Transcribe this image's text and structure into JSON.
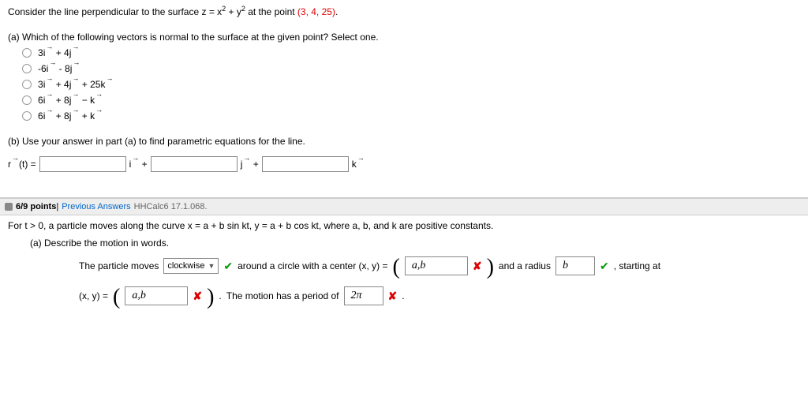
{
  "q1": {
    "intro_a": "Consider the line perpendicular to the surface z = x",
    "intro_b": " + y",
    "intro_c": " at the point ",
    "point": "(3, 4, 25)",
    "period": ".",
    "partA": "(a) Which of the following vectors is normal to the surface at the given point? Select one.",
    "opts": [
      [
        {
          "c": "3",
          "v": "i"
        },
        {
          "t": " + "
        },
        {
          "c": "4",
          "v": "j"
        }
      ],
      [
        {
          "c": "-6",
          "v": "i"
        },
        {
          "t": " - "
        },
        {
          "c": "8",
          "v": "j"
        }
      ],
      [
        {
          "c": "3",
          "v": "i"
        },
        {
          "t": " + "
        },
        {
          "c": "4",
          "v": "j"
        },
        {
          "t": " + "
        },
        {
          "c": "25",
          "v": "k"
        }
      ],
      [
        {
          "c": "6",
          "v": "i"
        },
        {
          "t": " + "
        },
        {
          "c": "8",
          "v": "j"
        },
        {
          "t": " − "
        },
        {
          "c": "",
          "v": "k"
        }
      ],
      [
        {
          "c": "6",
          "v": "i"
        },
        {
          "t": " + "
        },
        {
          "c": "8",
          "v": "j"
        },
        {
          "t": " + "
        },
        {
          "c": "",
          "v": "k"
        }
      ]
    ],
    "partB": "(b) Use your answer in part (a) to find parametric equations for the line.",
    "rt": "r(t) = ",
    "iplus": "i +",
    "jplus": "j +",
    "kend": "k"
  },
  "hdr": {
    "pts": "6/9 points",
    "sep": " | ",
    "prev": "Previous Answers",
    "ref": " HHCalc6 17.1.068."
  },
  "q2": {
    "intro": "For  t > 0,  a particle moves along the curve  x = a + b sin kt,   y = a + b cos kt,  where a, b, and k are positive constants.",
    "partA": "(a) Describe the motion in words.",
    "t1": "The particle moves ",
    "sel": "clockwise",
    "t2": " around a circle with a center  (x, y) = ",
    "ab": "a,b",
    "t3": " and a radius ",
    "b": "b",
    "t4": " , starting at",
    "xy": "(x, y) = ",
    "t5": " The motion has a period of ",
    "twopi": "2π",
    "dot": " ."
  }
}
